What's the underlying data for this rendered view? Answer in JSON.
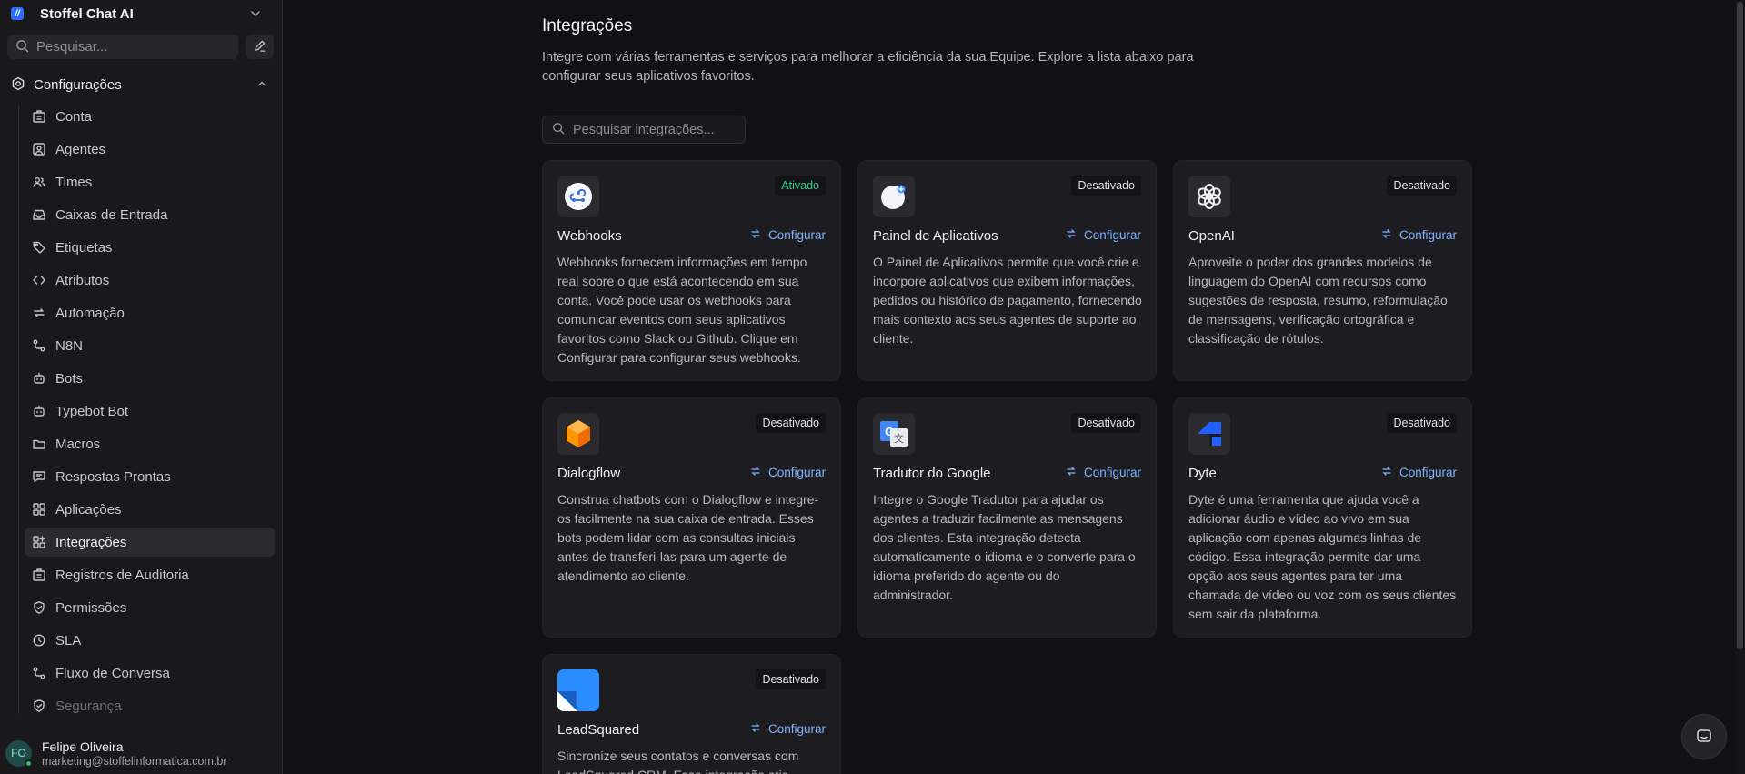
{
  "app": {
    "brand_name": "Stoffel Chat AI",
    "search_placeholder": "Pesquisar...",
    "section_label": "Configurações"
  },
  "sidebar": {
    "items": [
      {
        "label": "Conta",
        "icon": "building-icon"
      },
      {
        "label": "Agentes",
        "icon": "user-square-icon"
      },
      {
        "label": "Times",
        "icon": "users-icon"
      },
      {
        "label": "Caixas de Entrada",
        "icon": "inbox-icon"
      },
      {
        "label": "Etiquetas",
        "icon": "tag-icon"
      },
      {
        "label": "Atributos",
        "icon": "code-icon"
      },
      {
        "label": "Automação",
        "icon": "repeat-icon"
      },
      {
        "label": "N8N",
        "icon": "workflow-icon"
      },
      {
        "label": "Bots",
        "icon": "bot-icon"
      },
      {
        "label": "Typebot Bot",
        "icon": "bot-icon"
      },
      {
        "label": "Macros",
        "icon": "folder-icon"
      },
      {
        "label": "Respostas Prontas",
        "icon": "message-square-icon"
      },
      {
        "label": "Aplicações",
        "icon": "apps-icon"
      },
      {
        "label": "Integrações",
        "icon": "apps-plus-icon",
        "active": true
      },
      {
        "label": "Registros de Auditoria",
        "icon": "building-icon"
      },
      {
        "label": "Permissões",
        "icon": "shield-icon"
      },
      {
        "label": "SLA",
        "icon": "clock-icon"
      },
      {
        "label": "Fluxo de Conversa",
        "icon": "workflow-icon"
      },
      {
        "label": "Segurança",
        "icon": "shield-icon"
      }
    ]
  },
  "user": {
    "initials": "FO",
    "name": "Felipe Oliveira",
    "email": "marketing@stoffelinformatica.com.br"
  },
  "main": {
    "title": "Integrações",
    "description": "Integre com várias ferramentas e serviços para melhorar a eficiência da sua Equipe. Explore a lista abaixo para configurar seus aplicativos favoritos.",
    "search_placeholder": "Pesquisar integrações..."
  },
  "integrations": [
    {
      "name": "Webhooks",
      "status": "Ativado",
      "configure": "Configurar",
      "icon": "webhook-icon",
      "description": "Webhooks fornecem informações em tempo real sobre o que está acontecendo em sua conta. Você pode usar os webhooks para comunicar eventos com seus aplicativos favoritos como Slack ou Github. Clique em Configurar para configurar seus webhooks."
    },
    {
      "name": "Painel de Aplicativos",
      "status": "Desativado",
      "configure": "Configurar",
      "icon": "dashboard-apps-icon",
      "description": "O Painel de Aplicativos permite que você crie e incorpore aplicativos que exibem informações, pedidos ou histórico de pagamento, fornecendo mais contexto aos seus agentes de suporte ao cliente."
    },
    {
      "name": "OpenAI",
      "status": "Desativado",
      "configure": "Configurar",
      "icon": "openai-icon",
      "description": "Aproveite o poder dos grandes modelos de linguagem do OpenAI com recursos como sugestões de resposta, resumo, reformulação de mensagens, verificação ortográfica e classificação de rótulos."
    },
    {
      "name": "Dialogflow",
      "status": "Desativado",
      "configure": "Configurar",
      "icon": "dialogflow-icon",
      "description": "Construa chatbots com o Dialogflow e integre-os facilmente na sua caixa de entrada. Esses bots podem lidar com as consultas iniciais antes de transferi-las para um agente de atendimento ao cliente."
    },
    {
      "name": "Tradutor do Google",
      "status": "Desativado",
      "configure": "Configurar",
      "icon": "google-translate-icon",
      "description": "Integre o Google Tradutor para ajudar os agentes a traduzir facilmente as mensagens dos clientes. Esta integração detecta automaticamente o idioma e o converte para o idioma preferido do agente ou do administrador."
    },
    {
      "name": "Dyte",
      "status": "Desativado",
      "configure": "Configurar",
      "icon": "dyte-icon",
      "description": "Dyte é uma ferramenta que ajuda você a adicionar áudio e vídeo ao vivo em sua aplicação com apenas algumas linhas de código. Essa integração permite dar uma opção aos seus agentes para ter uma chamada de vídeo ou voz com os seus clientes sem sair da plataforma."
    },
    {
      "name": "LeadSquared",
      "status": "Desativado",
      "configure": "Configurar",
      "icon": "leadsquared-icon",
      "description": "Sincronize seus contatos e conversas com LeadSquared CRM. Essa integração cria"
    }
  ],
  "colors": {
    "accent": "#7fb2ff",
    "enabled": "#2fd08a",
    "background": "#111114",
    "card": "#1d1d21"
  }
}
